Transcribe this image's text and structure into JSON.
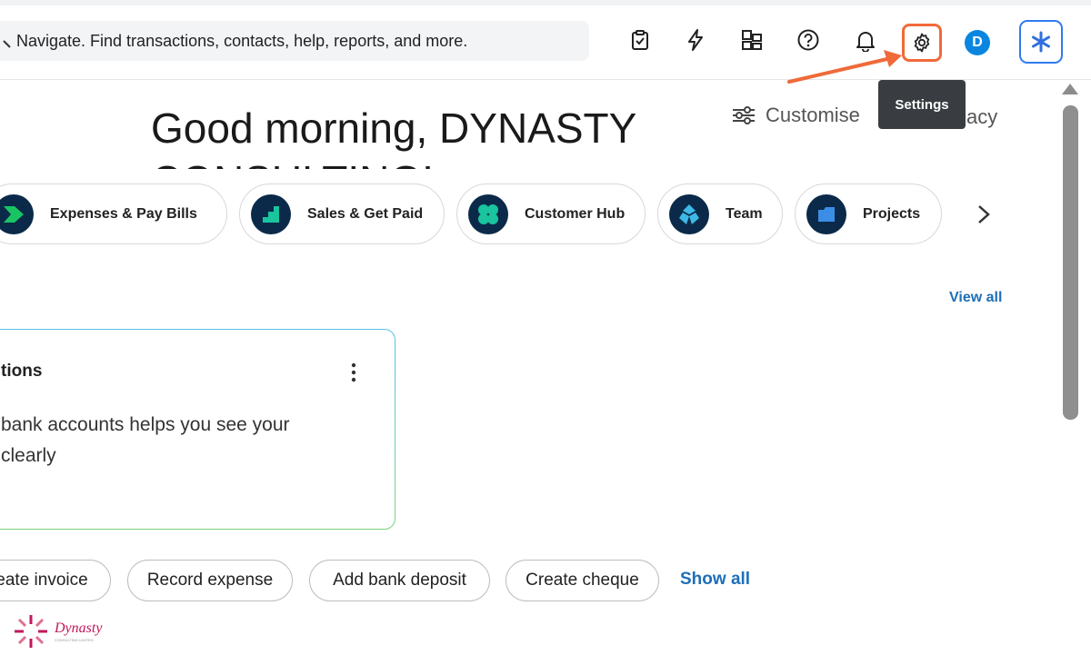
{
  "search": {
    "placeholder": "Navigate. Find transactions, contacts, help, reports, and more."
  },
  "toolbar": {
    "icons": [
      "tasks-icon",
      "flash-icon",
      "apps-icon",
      "help-icon",
      "bell-icon",
      "gear-icon"
    ],
    "avatar_letter": "D",
    "tooltip": "Settings",
    "highlight_color": "#f06a3a"
  },
  "greeting": {
    "text": "Good morning, DYNASTY CONSULTING!"
  },
  "header_actions": {
    "customise": "Customise",
    "privacy": "acy"
  },
  "apps": [
    {
      "label": "Expenses & Pay Bills",
      "icon": "expenses-icon",
      "color": "#19c463"
    },
    {
      "label": "Sales & Get Paid",
      "icon": "sales-icon",
      "color": "#19c49e"
    },
    {
      "label": "Customer Hub",
      "icon": "customer-hub-icon",
      "color": "#19c49e"
    },
    {
      "label": "Team",
      "icon": "team-icon",
      "color": "#3fb8e6"
    },
    {
      "label": "Projects",
      "icon": "projects-icon",
      "color": "#3b8de6"
    }
  ],
  "view_all": "View all",
  "card": {
    "title": "tions",
    "body_line1": "bank accounts helps you see your",
    "body_line2": "clearly"
  },
  "actions": {
    "items": [
      "eate invoice",
      "Record expense",
      "Add bank deposit",
      "Create cheque"
    ],
    "show_all": "Show all"
  },
  "logo": {
    "text": "Dynasty",
    "subtext": "CONSULTING LIMITED"
  }
}
